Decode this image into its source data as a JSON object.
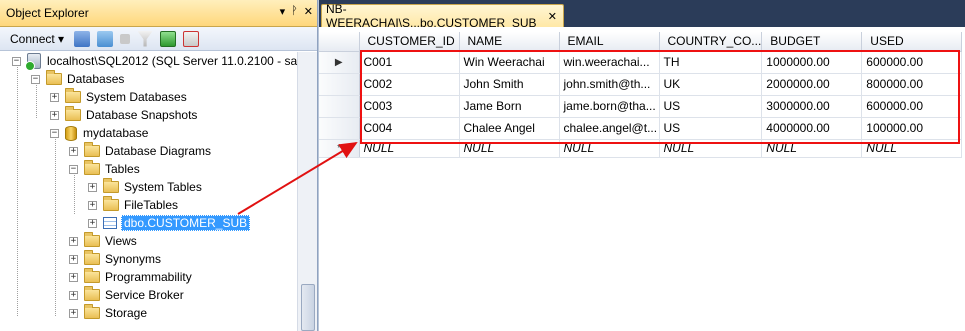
{
  "object_explorer": {
    "title": "Object Explorer",
    "title_buttons": [
      "▾",
      "ᚹ",
      "✕"
    ],
    "connect_label": "Connect ▾",
    "tree": [
      {
        "label": "localhost\\SQL2012 (SQL Server 11.0.2100 - sa)",
        "icon": "server-icon",
        "expander": "−"
      },
      {
        "label": "Databases",
        "icon": "folder-icon",
        "expander": "−"
      },
      {
        "label": "System Databases",
        "icon": "folder-icon",
        "expander": "+"
      },
      {
        "label": "Database Snapshots",
        "icon": "folder-icon",
        "expander": "+"
      },
      {
        "label": "mydatabase",
        "icon": "database-icon",
        "expander": "−"
      },
      {
        "label": "Database Diagrams",
        "icon": "folder-icon",
        "expander": "+"
      },
      {
        "label": "Tables",
        "icon": "folder-icon",
        "expander": "−"
      },
      {
        "label": "System Tables",
        "icon": "folder-icon",
        "expander": "+"
      },
      {
        "label": "FileTables",
        "icon": "folder-icon",
        "expander": "+"
      },
      {
        "label": "dbo.CUSTOMER_SUB",
        "icon": "table-icon",
        "expander": "+"
      },
      {
        "label": "Views",
        "icon": "folder-icon",
        "expander": "+"
      },
      {
        "label": "Synonyms",
        "icon": "folder-icon",
        "expander": "+"
      },
      {
        "label": "Programmability",
        "icon": "folder-icon",
        "expander": "+"
      },
      {
        "label": "Service Broker",
        "icon": "folder-icon",
        "expander": "+"
      },
      {
        "label": "Storage",
        "icon": "folder-icon",
        "expander": "+"
      }
    ]
  },
  "document": {
    "tab_title": "NB-WEERACHAI\\S...bo.CUSTOMER_SUB",
    "tab_close": "✕",
    "columns": [
      "CUSTOMER_ID",
      "NAME",
      "EMAIL",
      "COUNTRY_CO...",
      "BUDGET",
      "USED"
    ],
    "rows": [
      [
        "C001",
        "Win Weerachai",
        "win.weerachai...",
        "TH",
        "1000000.00",
        "600000.00"
      ],
      [
        "C002",
        "John  Smith",
        "john.smith@th...",
        "UK",
        "2000000.00",
        "800000.00"
      ],
      [
        "C003",
        "Jame Born",
        "jame.born@tha...",
        "US",
        "3000000.00",
        "600000.00"
      ],
      [
        "C004",
        "Chalee Angel",
        "chalee.angel@t...",
        "US",
        "4000000.00",
        "100000.00"
      ]
    ],
    "null_row": [
      "NULL",
      "NULL",
      "NULL",
      "NULL",
      "NULL",
      "NULL"
    ],
    "current_row_marker": "▶",
    "new_row_marker": "*"
  },
  "colors": {
    "highlight_box": "#e11111",
    "selection": "#3399ff"
  }
}
